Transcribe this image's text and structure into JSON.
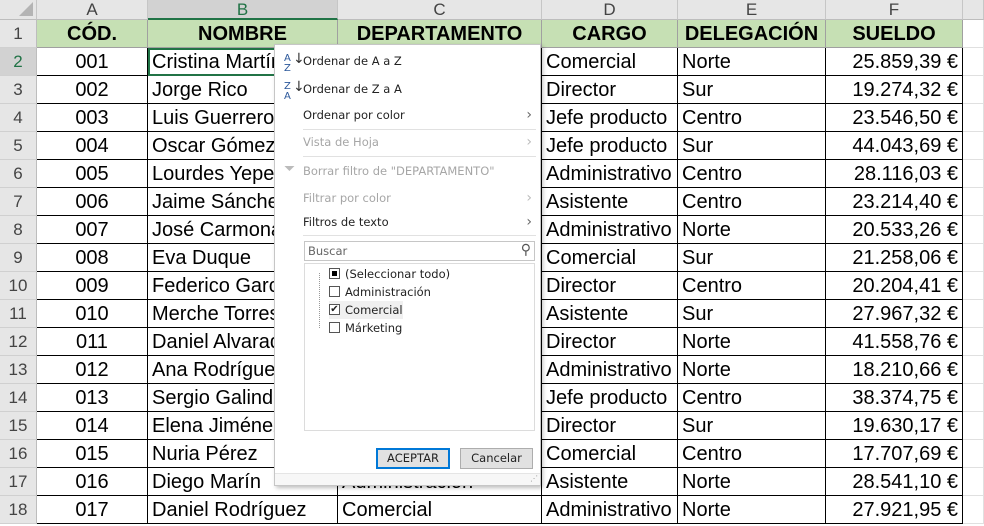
{
  "columns": [
    "A",
    "B",
    "C",
    "D",
    "E",
    "F"
  ],
  "selected_column": "B",
  "headers": [
    "CÓD.",
    "NOMBRE",
    "DEPARTAMENTO",
    "CARGO",
    "DELEGACIÓN",
    "SUELDO"
  ],
  "rows": [
    [
      "001",
      "Cristina Martínez",
      "",
      "Comercial",
      "Norte",
      "25.859,39 €"
    ],
    [
      "002",
      "Jorge Rico",
      "",
      "Director",
      "Sur",
      "19.274,32 €"
    ],
    [
      "003",
      "Luis Guerrero",
      "",
      "Jefe producto",
      "Centro",
      "23.546,50 €"
    ],
    [
      "004",
      "Oscar Gómez",
      "",
      "Jefe producto",
      "Sur",
      "44.043,69 €"
    ],
    [
      "005",
      "Lourdes Yepes",
      "",
      "Administrativo",
      "Centro",
      "28.116,03 €"
    ],
    [
      "006",
      "Jaime Sánchez",
      "",
      "Asistente",
      "Centro",
      "23.214,40 €"
    ],
    [
      "007",
      "José Carmona",
      "",
      "Administrativo",
      "Norte",
      "20.533,26 €"
    ],
    [
      "008",
      "Eva Duque",
      "",
      "Comercial",
      "Sur",
      "21.258,06 €"
    ],
    [
      "009",
      "Federico García",
      "",
      "Director",
      "Centro",
      "20.204,41 €"
    ],
    [
      "010",
      "Merche Torres",
      "",
      "Asistente",
      "Sur",
      "27.967,32 €"
    ],
    [
      "011",
      "Daniel Alvarado",
      "",
      "Director",
      "Norte",
      "41.558,76 €"
    ],
    [
      "012",
      "Ana Rodríguez",
      "",
      "Administrativo",
      "Norte",
      "18.210,66 €"
    ],
    [
      "013",
      "Sergio Galindo",
      "",
      "Jefe producto",
      "Centro",
      "38.374,75 €"
    ],
    [
      "014",
      "Elena Jiménez",
      "",
      "Director",
      "Sur",
      "19.630,17 €"
    ],
    [
      "015",
      "Nuria Pérez",
      "",
      "Comercial",
      "Centro",
      "17.707,69 €"
    ],
    [
      "016",
      "Diego Marín",
      "Administración",
      "Asistente",
      "Norte",
      "28.541,10 €"
    ],
    [
      "017",
      "Daniel Rodríguez",
      "Comercial",
      "Administrativo",
      "Norte",
      "27.921,95 €"
    ]
  ],
  "menu": {
    "sort_az": "Ordenar de A a Z",
    "sort_za": "Ordenar de Z a A",
    "sort_color": "Ordenar por color",
    "sheet_view": "Vista de Hoja",
    "clear_filter": "Borrar filtro de \"DEPARTAMENTO\"",
    "filter_color": "Filtrar por color",
    "text_filters": "Filtros de texto",
    "search_placeholder": "Buscar",
    "items": [
      {
        "label": "(Seleccionar todo)",
        "state": "partial"
      },
      {
        "label": "Administración",
        "state": "unchecked"
      },
      {
        "label": "Comercial",
        "state": "checked"
      },
      {
        "label": "Márketing",
        "state": "unchecked"
      }
    ],
    "ok": "ACEPTAR",
    "cancel": "Cancelar"
  }
}
